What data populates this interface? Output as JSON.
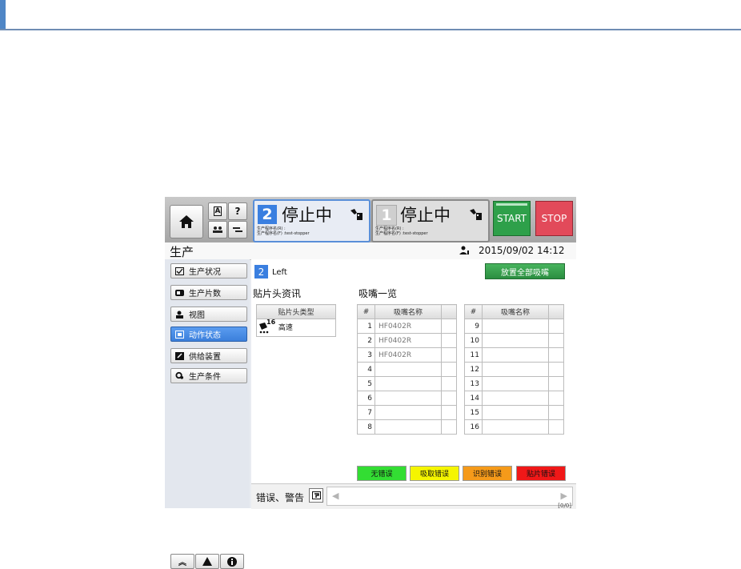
{
  "header": {
    "lanes": [
      {
        "number": "2",
        "state": "停止中",
        "program_r": "生产程序名(R) :",
        "program_f": "生产程序名(F) :test-stopper"
      },
      {
        "number": "1",
        "state": "停止中",
        "program_r": "生产程序名(R) :",
        "program_f": "生产程序名(F) :test-stopper"
      }
    ],
    "small_buttons": {
      "a_label": "A",
      "help_label": "?"
    },
    "start_label": "START",
    "stop_label": "STOP"
  },
  "titlebar": {
    "title": "生产",
    "datetime": "2015/09/02 14:12"
  },
  "sidebar": {
    "items": [
      {
        "label": "生产状况",
        "icon": "checkbox-icon"
      },
      {
        "label": "生产片数",
        "icon": "counter-icon"
      },
      {
        "label": "视图",
        "icon": "view-icon"
      },
      {
        "label": "动作状态",
        "icon": "action-status-icon"
      },
      {
        "label": "供给装置",
        "icon": "feeder-icon"
      },
      {
        "label": "生产条件",
        "icon": "settings-icon"
      }
    ]
  },
  "main": {
    "head_number": "2",
    "head_label": "Left",
    "place_all_label": "放置全部吸嘴",
    "head_info_title": "贴片头资讯",
    "nozzle_list_title": "吸嘴一览",
    "head_table": {
      "header": "贴片头类型",
      "badge": "16",
      "value": "高速"
    },
    "nozzle_tables": [
      {
        "col_num": "#",
        "col_name": "吸嘴名称",
        "rows": [
          {
            "n": "1",
            "name": "HF0402R"
          },
          {
            "n": "2",
            "name": "HF0402R"
          },
          {
            "n": "3",
            "name": "HF0402R"
          },
          {
            "n": "4",
            "name": ""
          },
          {
            "n": "5",
            "name": ""
          },
          {
            "n": "6",
            "name": ""
          },
          {
            "n": "7",
            "name": ""
          },
          {
            "n": "8",
            "name": ""
          }
        ]
      },
      {
        "col_num": "#",
        "col_name": "吸嘴名称",
        "rows": [
          {
            "n": "9",
            "name": ""
          },
          {
            "n": "10",
            "name": ""
          },
          {
            "n": "11",
            "name": ""
          },
          {
            "n": "12",
            "name": ""
          },
          {
            "n": "13",
            "name": ""
          },
          {
            "n": "14",
            "name": ""
          },
          {
            "n": "15",
            "name": ""
          },
          {
            "n": "16",
            "name": ""
          }
        ]
      }
    ],
    "legend": [
      {
        "label": "无错误",
        "color": "#33dd33"
      },
      {
        "label": "吸取错误",
        "color": "#f5f500"
      },
      {
        "label": "识别错误",
        "color": "#f59a1a"
      },
      {
        "label": "贴片错误",
        "color": "#f01818"
      }
    ],
    "error_label": "错误、警告",
    "error_counter": "[0/0]"
  }
}
